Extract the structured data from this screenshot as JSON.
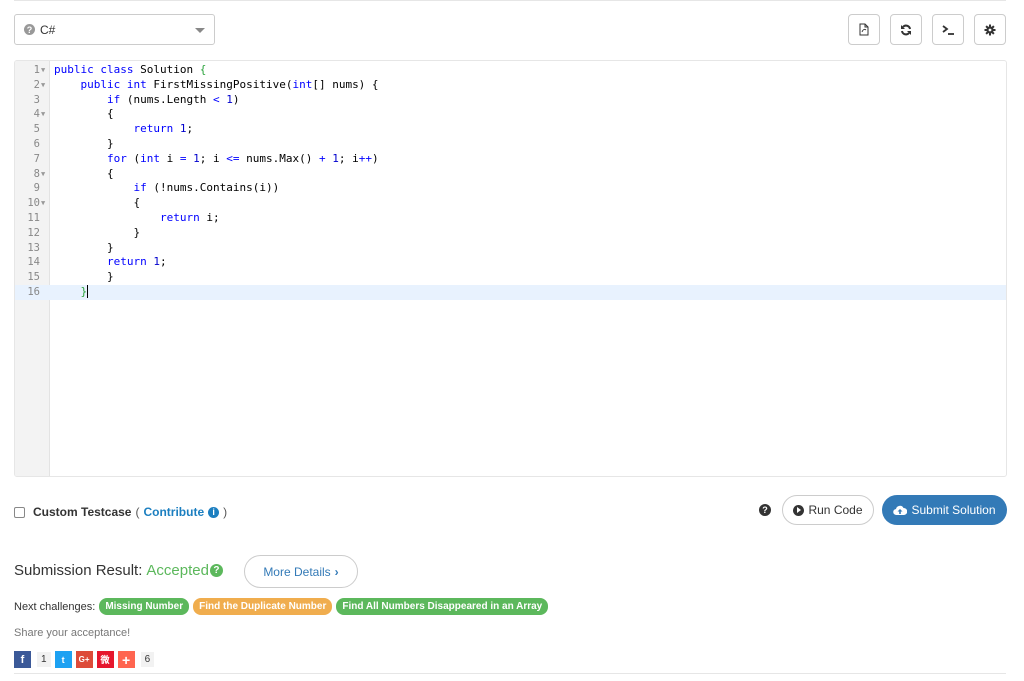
{
  "language": {
    "selected": "C#"
  },
  "toolbar": {
    "buttons": [
      "load-file",
      "reset",
      "console",
      "settings"
    ]
  },
  "editor": {
    "lines": [
      {
        "n": "1",
        "fold": true,
        "indent": 0,
        "text": "public class Solution {"
      },
      {
        "n": "2",
        "fold": true,
        "indent": 4,
        "text": "public int FirstMissingPositive(int[] nums) {"
      },
      {
        "n": "3",
        "fold": false,
        "indent": 8,
        "text": "if (nums.Length < 1)"
      },
      {
        "n": "4",
        "fold": true,
        "indent": 8,
        "text": "{"
      },
      {
        "n": "5",
        "fold": false,
        "indent": 12,
        "text": "return 1;"
      },
      {
        "n": "6",
        "fold": false,
        "indent": 8,
        "text": "}"
      },
      {
        "n": "7",
        "fold": false,
        "indent": 8,
        "text": "for (int i = 1; i <= nums.Max() + 1; i++)"
      },
      {
        "n": "8",
        "fold": true,
        "indent": 8,
        "text": "{"
      },
      {
        "n": "9",
        "fold": false,
        "indent": 12,
        "text": "if (!nums.Contains(i))"
      },
      {
        "n": "10",
        "fold": true,
        "indent": 12,
        "text": "{"
      },
      {
        "n": "11",
        "fold": false,
        "indent": 16,
        "text": "return i;"
      },
      {
        "n": "12",
        "fold": false,
        "indent": 12,
        "text": "}"
      },
      {
        "n": "13",
        "fold": false,
        "indent": 8,
        "text": "}"
      },
      {
        "n": "14",
        "fold": false,
        "indent": 8,
        "text": "return 1;"
      },
      {
        "n": "15",
        "fold": false,
        "indent": 8,
        "text": "}"
      },
      {
        "n": "16",
        "fold": false,
        "indent": 4,
        "text": "}",
        "active": true
      }
    ]
  },
  "custom_testcase": {
    "label": "Custom Testcase",
    "open_paren": "(",
    "contribute": "Contribute",
    "close_paren": ")"
  },
  "actions": {
    "run": "Run Code",
    "submit": "Submit Solution"
  },
  "result": {
    "label": "Submission Result:",
    "status": "Accepted",
    "more_details": "More Details"
  },
  "next_challenges": {
    "label": "Next challenges:",
    "items": [
      {
        "title": "Missing Number",
        "color": "#5cb85c"
      },
      {
        "title": "Find the Duplicate Number",
        "color": "#f0ad4e"
      },
      {
        "title": "Find All Numbers Disappeared in an Array",
        "color": "#5cb85c"
      }
    ]
  },
  "share": {
    "label": "Share your acceptance!",
    "facebook_count": "1",
    "total_count": "6",
    "networks": [
      {
        "name": "facebook",
        "glyph": "f",
        "color": "#3b5998"
      },
      {
        "name": "twitter",
        "glyph": "t",
        "color": "#1da1f2"
      },
      {
        "name": "google-plus",
        "glyph": "G+",
        "color": "#dd4b39"
      },
      {
        "name": "weibo",
        "glyph": "微",
        "color": "#e6162d"
      },
      {
        "name": "more",
        "glyph": "+",
        "color": "#ff6550"
      }
    ]
  }
}
